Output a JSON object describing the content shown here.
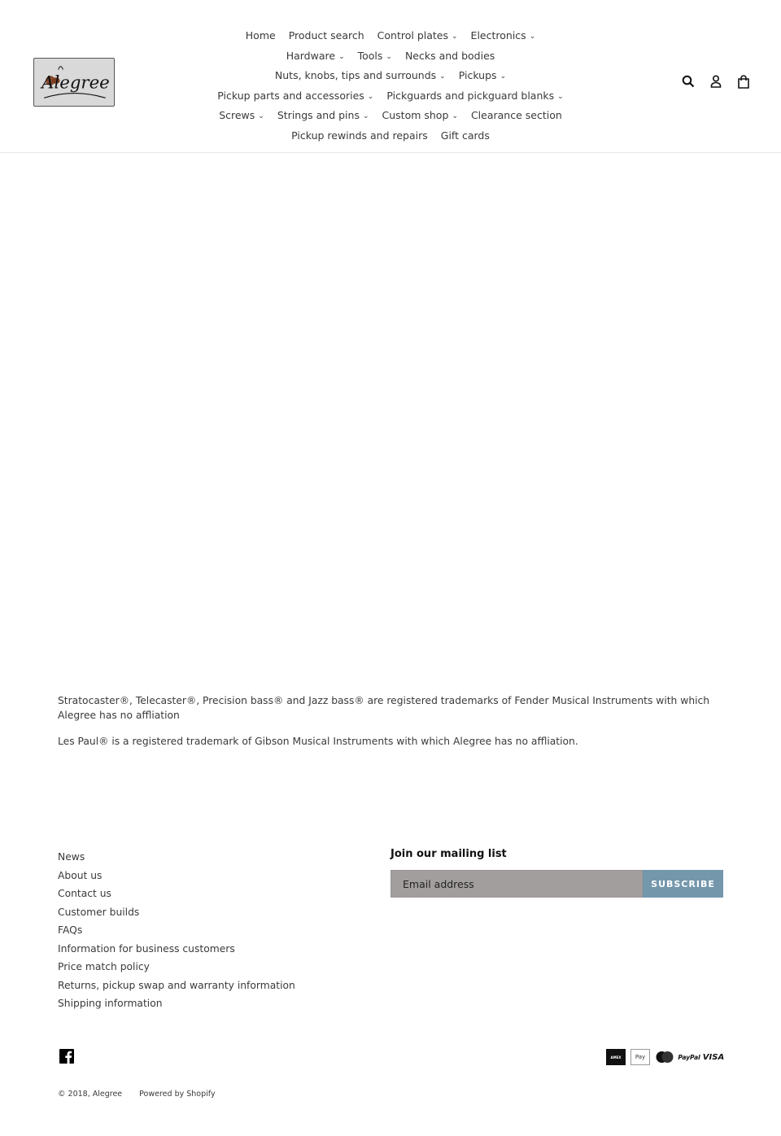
{
  "brand": {
    "name": "Alegree",
    "logo_alt": "Alegree"
  },
  "nav": {
    "rows": [
      [
        {
          "label": "Home",
          "dropdown": false
        },
        {
          "label": "Product search",
          "dropdown": false
        },
        {
          "label": "Control plates",
          "dropdown": true
        },
        {
          "label": "Electronics",
          "dropdown": true
        }
      ],
      [
        {
          "label": "Hardware",
          "dropdown": true
        },
        {
          "label": "Tools",
          "dropdown": true
        },
        {
          "label": "Necks and bodies",
          "dropdown": false
        }
      ],
      [
        {
          "label": "Nuts, knobs, tips and surrounds",
          "dropdown": true
        },
        {
          "label": "Pickups",
          "dropdown": true
        }
      ],
      [
        {
          "label": "Pickup parts and accessories",
          "dropdown": true
        },
        {
          "label": "Pickguards and pickguard blanks",
          "dropdown": true
        }
      ],
      [
        {
          "label": "Screws",
          "dropdown": true
        },
        {
          "label": "Strings and pins",
          "dropdown": true
        },
        {
          "label": "Custom shop",
          "dropdown": true
        },
        {
          "label": "Clearance section",
          "dropdown": false
        }
      ],
      [
        {
          "label": "Pickup rewinds and repairs",
          "dropdown": false
        },
        {
          "label": "Gift cards",
          "dropdown": false
        }
      ]
    ],
    "chevron_glyph": "⌄"
  },
  "header_icons": [
    "search-icon",
    "account-icon",
    "cart-icon"
  ],
  "legal": {
    "p1": "Stratocaster®, Telecaster®, Precision bass® and Jazz bass® are registered trademarks of Fender Musical Instruments with which Alegree has no affliation",
    "p2": "Les Paul® is a registered trademark of Gibson Musical Instruments with which Alegree has no affliation."
  },
  "footer": {
    "links": [
      "News",
      "About us",
      "Contact us",
      "Customer builds",
      "FAQs",
      "Information for business customers",
      "Price match policy",
      "Returns, pickup swap and warranty information",
      "Shipping information"
    ],
    "mailing": {
      "title": "Join our mailing list",
      "placeholder": "Email address",
      "button": "SUBSCRIBE"
    },
    "payments": [
      "American Express",
      "Apple Pay",
      "Master",
      "PayPal",
      "VISA"
    ],
    "copyright": "© 2018, Alegree",
    "powered": "Powered by Shopify"
  },
  "colors": {
    "subscribe_bg": "#7497ac",
    "email_bg": "#a39e9e"
  }
}
